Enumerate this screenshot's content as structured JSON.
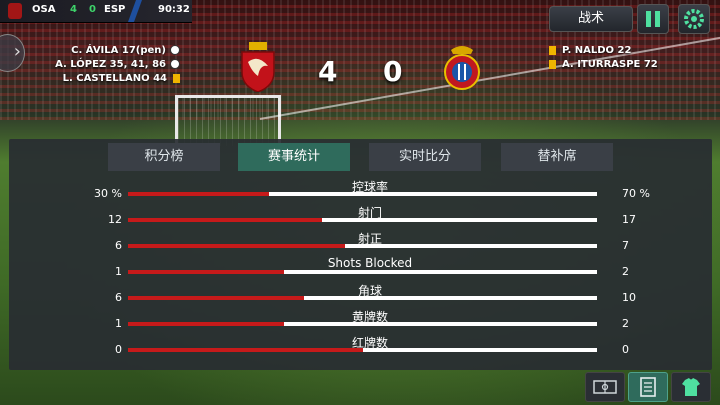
{
  "scoreboard": {
    "home_abbr": "OSA",
    "home_score": "4",
    "away_score": "0",
    "away_abbr": "ESP",
    "clock": "90:32"
  },
  "match": {
    "home_score": "4",
    "away_score": "0",
    "home_events": [
      {
        "text": "C. ÁVILA 17(pen)",
        "icon": "ball-icon"
      },
      {
        "text": "A. LÓPEZ 35, 41, 86",
        "icon": "ball-icon"
      },
      {
        "text": "L. CASTELLANO 44",
        "icon": "yellow-card-icon"
      }
    ],
    "away_events": [
      {
        "text": "P. NALDO 22",
        "icon": "yellow-card-icon"
      },
      {
        "text": "A. ITURRASPE 72",
        "icon": "yellow-card-icon"
      }
    ]
  },
  "header_buttons": {
    "tactics_label": "战术",
    "pause_icon": "pause-icon",
    "settings_icon": "gear-icon"
  },
  "tabs": [
    {
      "label": "积分榜",
      "active": false
    },
    {
      "label": "赛事统计",
      "active": true
    },
    {
      "label": "实时比分",
      "active": false
    },
    {
      "label": "替补席",
      "active": false
    }
  ],
  "stats": [
    {
      "label": "控球率",
      "home": "30 %",
      "away": "70 %",
      "home_share": 0.3
    },
    {
      "label": "射门",
      "home": "12",
      "away": "17",
      "home_share": 0.414
    },
    {
      "label": "射正",
      "home": "6",
      "away": "7",
      "home_share": 0.462
    },
    {
      "label": "Shots Blocked",
      "home": "1",
      "away": "2",
      "home_share": 0.333
    },
    {
      "label": "角球",
      "home": "6",
      "away": "10",
      "home_share": 0.375
    },
    {
      "label": "黄牌数",
      "home": "1",
      "away": "2",
      "home_share": 0.333
    },
    {
      "label": "红牌数",
      "home": "0",
      "away": "0",
      "home_share": 0.5
    }
  ],
  "bottom_buttons": [
    {
      "icon": "pitch-icon",
      "active": false
    },
    {
      "icon": "clipboard-icon",
      "active": true
    },
    {
      "icon": "shirt-icon",
      "active": false
    }
  ],
  "colors": {
    "home_bar": "#c61a1a",
    "away_bar": "#ffffff",
    "active_tab": "#2f6b5c",
    "accent_green": "#4fe0a0"
  }
}
